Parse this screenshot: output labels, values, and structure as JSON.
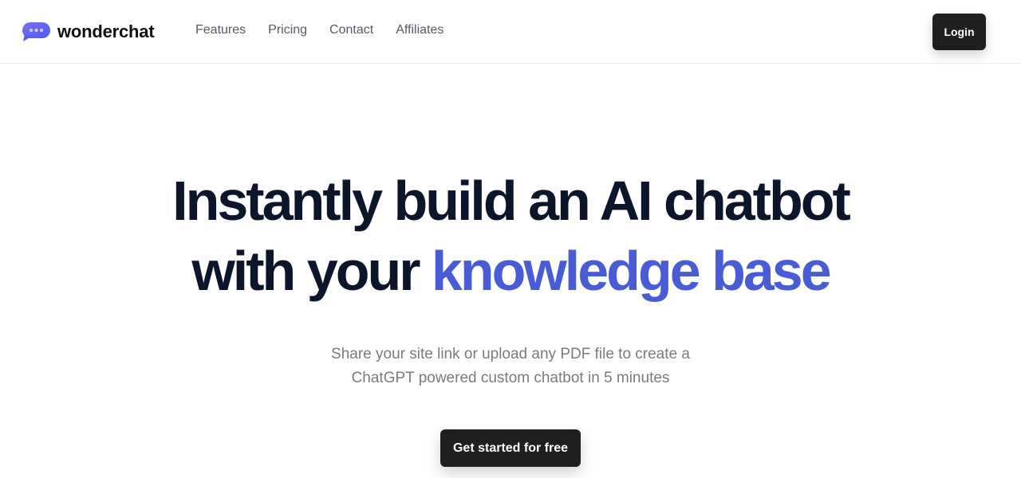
{
  "brand": {
    "name": "wonderchat",
    "icon": "chat-bubble-icon",
    "accent_color": "#5b5ef0"
  },
  "nav": {
    "items": [
      {
        "label": "Features"
      },
      {
        "label": "Pricing"
      },
      {
        "label": "Contact"
      },
      {
        "label": "Affiliates"
      }
    ]
  },
  "header": {
    "login_label": "Login"
  },
  "hero": {
    "title_line1": "Instantly build an AI chatbot",
    "title_line2_prefix": "with your ",
    "title_line2_accent": "knowledge base",
    "accent_color": "#4a5bd6",
    "subtitle_line1": "Share your site link or upload any PDF file to create a",
    "subtitle_line2": "ChatGPT powered custom chatbot in 5 minutes",
    "cta_label": "Get started for free"
  }
}
